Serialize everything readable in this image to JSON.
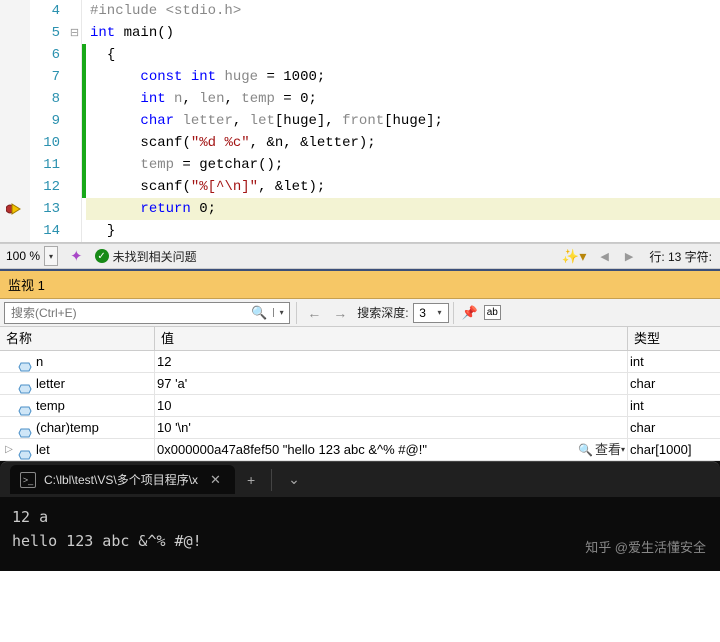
{
  "editor": {
    "lines": [
      {
        "n": 4,
        "fold": "",
        "bar": false,
        "html": "<span class='inc'>#include</span> <span class='inc'>&lt;stdio.h&gt;</span>"
      },
      {
        "n": 5,
        "fold": "⊟",
        "bar": false,
        "html": "<span class='kw'>int</span> <span class='ident'>main</span><span class='paren'>()</span>"
      },
      {
        "n": 6,
        "fold": "",
        "bar": true,
        "html": "<span class='ident'>{</span>"
      },
      {
        "n": 7,
        "fold": "",
        "bar": true,
        "html": "    <span class='kw'>const</span> <span class='kw'>int</span> <span class='gray-name'>huge</span> = 1000;"
      },
      {
        "n": 8,
        "fold": "",
        "bar": true,
        "html": "    <span class='kw'>int</span> <span class='gray-name'>n</span>, <span class='gray-name'>len</span>, <span class='gray-name'>temp</span> = 0;"
      },
      {
        "n": 9,
        "fold": "",
        "bar": true,
        "html": "    <span class='kw'>char</span> <span class='gray-name'>letter</span>, <span class='gray-name'>let</span>[huge], <span class='gray-name'>front</span>[huge];"
      },
      {
        "n": 10,
        "fold": "",
        "bar": true,
        "html": "    <span class='ident'>scanf</span>(<span class='str'>\"%d %c\"</span>, &amp;n, &amp;letter);"
      },
      {
        "n": 11,
        "fold": "",
        "bar": true,
        "html": "    <span class='gray-name'>temp</span> = <span class='ident'>getchar</span>();"
      },
      {
        "n": 12,
        "fold": "",
        "bar": true,
        "html": "    <span class='ident'>scanf</span>(<span class='str'>\"%[^\\n]\"</span>, &amp;let);"
      },
      {
        "n": 13,
        "fold": "",
        "bar": false,
        "html": "    <span class='kw'>return</span> 0;",
        "hl": true,
        "arrow": true
      },
      {
        "n": 14,
        "fold": "",
        "bar": false,
        "html": "<span class='ident'>}</span>"
      }
    ]
  },
  "status": {
    "zoom": "100 %",
    "issues": "未找到相关问题",
    "line_col": "行: 13    字符:"
  },
  "panel_title": "监视 1",
  "search": {
    "placeholder": "搜索(Ctrl+E)",
    "depth_label": "搜索深度:",
    "depth_value": "3"
  },
  "table": {
    "headers": {
      "name": "名称",
      "value": "值",
      "type": "类型"
    },
    "rows": [
      {
        "name": "n",
        "value": "12",
        "type": "int",
        "expand": ""
      },
      {
        "name": "letter",
        "value": "97 'a'",
        "type": "char",
        "expand": ""
      },
      {
        "name": "temp",
        "value": "10",
        "type": "int",
        "expand": ""
      },
      {
        "name": "(char)temp",
        "value": "10 '\\n'",
        "type": "char",
        "expand": ""
      },
      {
        "name": "let",
        "value": "0x000000a47a8fef50 \"hello 123 abc &^% #@!\"",
        "type": "char[1000]",
        "expand": "▷",
        "view": true
      }
    ],
    "view_label": "查看"
  },
  "terminal": {
    "tab_title": "C:\\lbl\\test\\VS\\多个项目程序\\x",
    "lines": [
      "12 a",
      "hello 123 abc &^% #@!"
    ],
    "watermark": "知乎 @爱生活懂安全"
  }
}
